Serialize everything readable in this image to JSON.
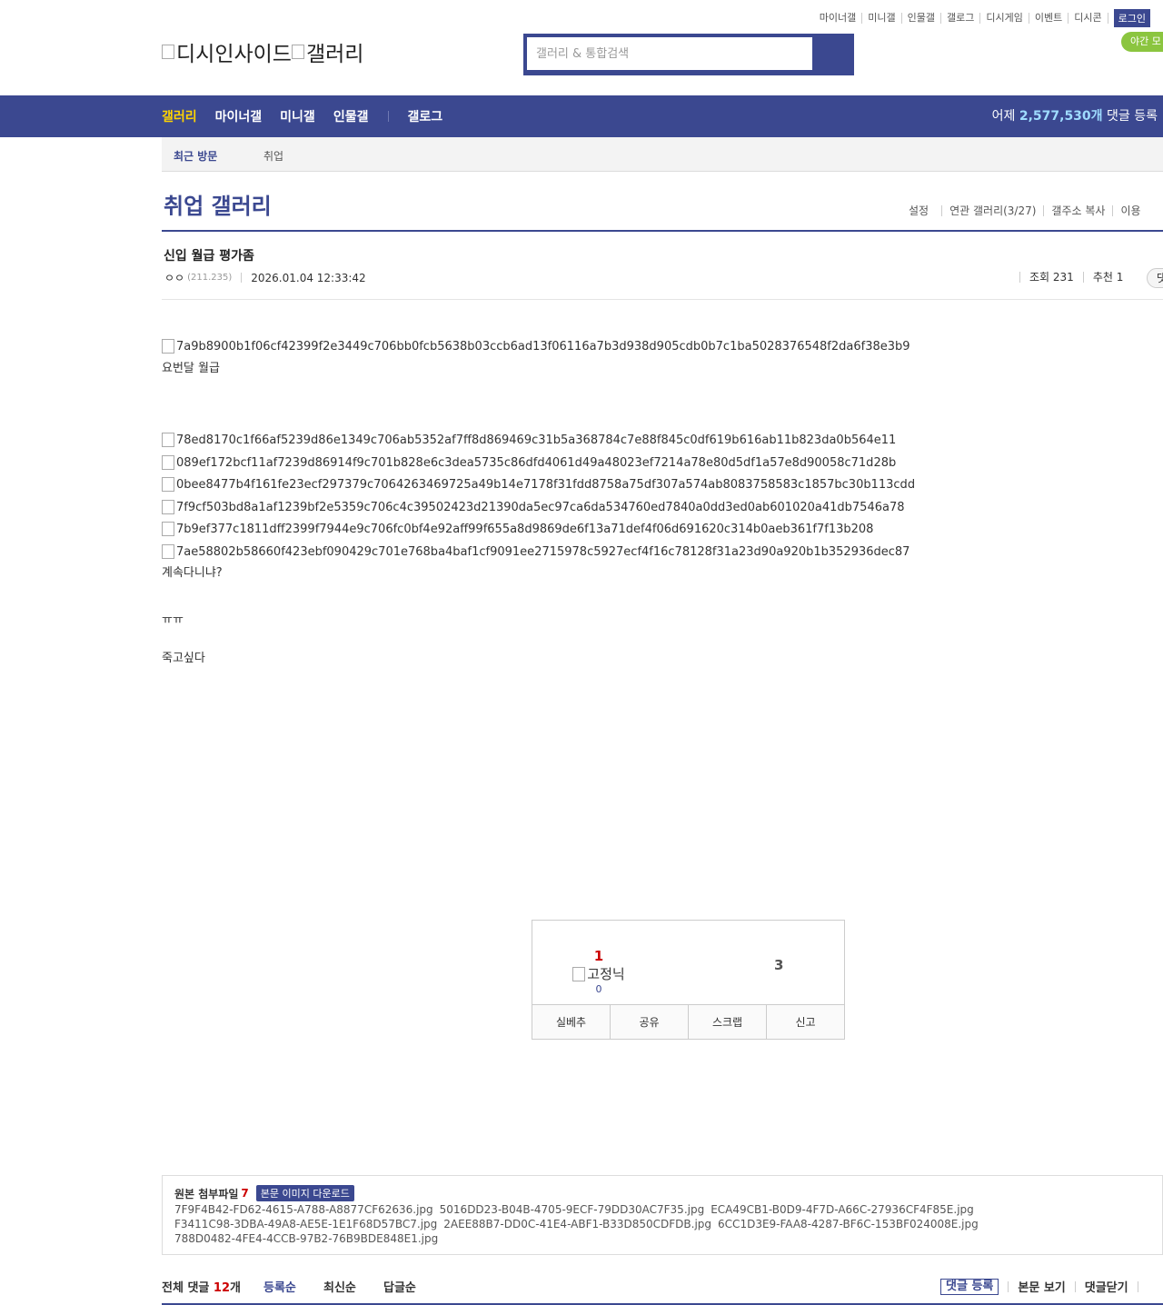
{
  "top_links": [
    "마이너갤",
    "미니갤",
    "인물갤",
    "갤로그",
    "디시게임",
    "이벤트",
    "디시콘"
  ],
  "login_label": "로그인",
  "night_label": "야간 모",
  "logo": {
    "site": "디시인사이드",
    "section": "갤러리"
  },
  "search": {
    "placeholder": "갤러리 & 통합검색"
  },
  "nav": {
    "items": [
      "갤러리",
      "마이너갤",
      "미니갤",
      "인물갤"
    ],
    "extra": "갤로그",
    "yesterday_prefix": "어제",
    "yesterday_count": "2,577,530개",
    "yesterday_suffix": "댓글 등록"
  },
  "recent": {
    "label": "최근 방문",
    "item": "취업"
  },
  "gallery": {
    "title": "취업 갤러리",
    "options": [
      "설정",
      "연관 갤러리(3/27)",
      "갤주소 복사",
      "이용"
    ]
  },
  "post": {
    "title": "신입 월급 평가좀",
    "writer": "ㅇㅇ",
    "ip": "(211.235)",
    "date": "2026.01.04 12:33:42",
    "views": "조회 231",
    "recommends": "추천 1",
    "reply_btn": "댓"
  },
  "body": {
    "img1": "7a9b8900b1f06cf42399f2e3449c706bb0fcb5638b03ccb6ad13f06116a7b3d938d905cdb0b7c1ba5028376548f2da6f38e3b9",
    "line1": "요번달 월급",
    "imgs": [
      "78ed8170c1f66af5239d86e1349c706ab5352af7ff8d869469c31b5a368784c7e88f845c0df619b616ab11b823da0b564e11",
      "089ef172bcf11af7239d86914f9c701b828e6c3dea5735c86dfd4061d49a48023ef7214a78e80d5df1a57e8d90058c71d28b",
      "0bee8477b4f161fe23ecf297379c7064263469725a49b14e7178f31fdd8758a75df307a574ab8083758583c1857bc30b113cdd",
      "7f9cf503bd8a1af1239bf2e5359c706c4c39502423d21390da5ec97ca6da534760ed7840a0dd3ed0ab601020a41db7546a78",
      "7b9ef377c1811dff2399f7944e9c706fc0bf4e92aff99f655a8d9869de6f13a71def4f06d691620c314b0aeb361f7f13b208",
      "7ae58802b58660f423ebf090429c701e768ba4baf1cf9091ee2715978c5927ecf4f16c78128f31a23d90a920b1b352936dec87"
    ],
    "line2": "계속다니냐?",
    "line3": "ㅠㅠ",
    "line4": "죽고싶다"
  },
  "recommend_box": {
    "up_count": "1",
    "fixed_nick_label": "고정닉",
    "fixed_count": "0",
    "down_count": "3",
    "buttons": [
      "실베추",
      "공유",
      "스크랩",
      "신고"
    ]
  },
  "attachments": {
    "label": "원본 첨부파일",
    "count": "7",
    "download_label": "본문 이미지 다운로드",
    "files": [
      "7F9F4B42-FD62-4615-A788-A8877CF62636.jpg",
      "5016DD23-B04B-4705-9ECF-79DD30AC7F35.jpg",
      "ECA49CB1-B0D9-4F7D-A66C-27936CF4F85E.jpg",
      "F3411C98-3DBA-49A8-AE5E-1E1F68D57BC7.jpg",
      "2AEE88B7-DD0C-41E4-ABF1-B33D850CDFDB.jpg",
      "6CC1D3E9-FAA8-4287-BF6C-153BF024008E.jpg",
      "788D0482-4FE4-4CCB-97B2-76B9BDE848E1.jpg"
    ]
  },
  "comments": {
    "total_prefix": "전체 댓글",
    "total_count": "12",
    "total_suffix": "개",
    "sort": [
      "등록순",
      "최신순",
      "답글순"
    ],
    "register": "댓글 등록",
    "view_body": "본문 보기",
    "close": "댓글닫기"
  },
  "colors": {
    "brand": "#3b4890",
    "accent_yellow": "#ffd400",
    "night_green": "#8bc53f",
    "count_red": "#cc0000"
  }
}
